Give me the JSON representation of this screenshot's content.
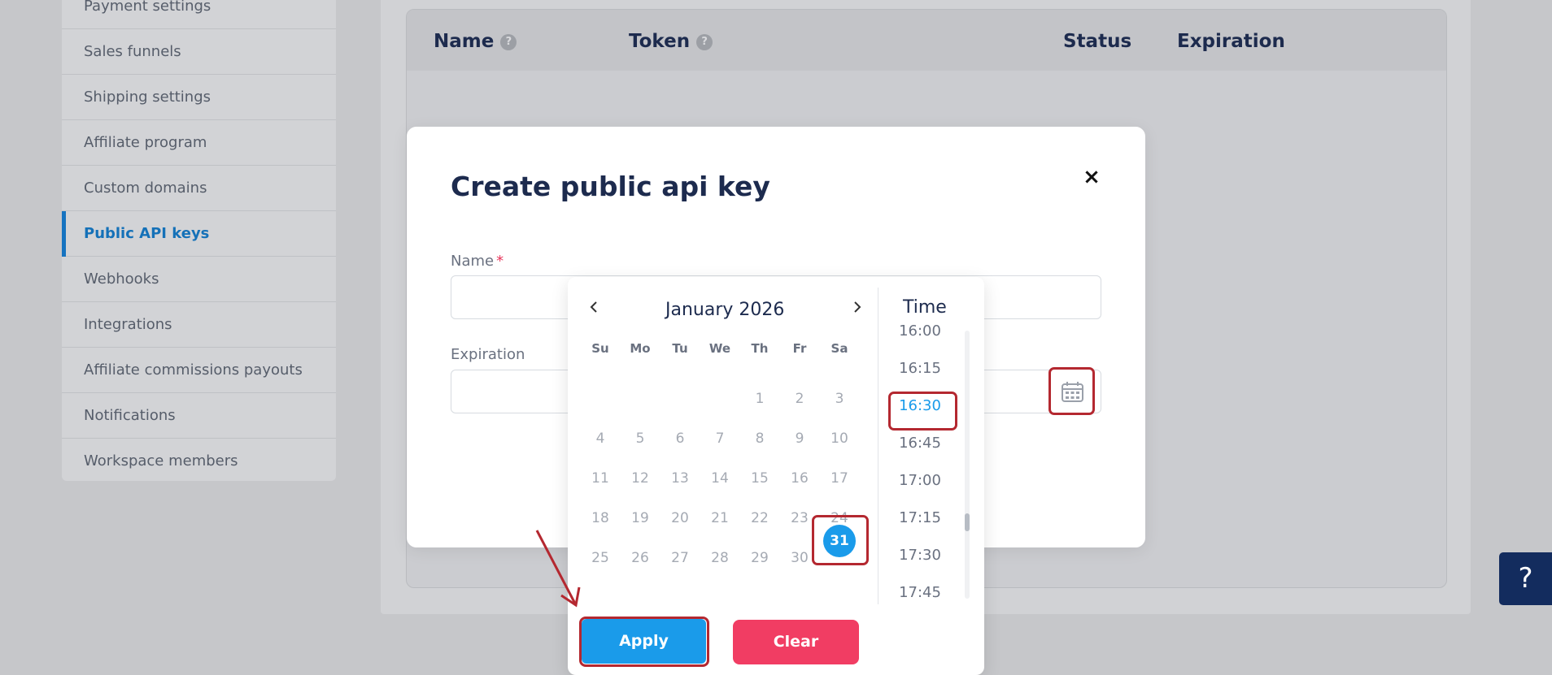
{
  "sidebar": {
    "items": [
      {
        "label": "Payment settings"
      },
      {
        "label": "Sales funnels"
      },
      {
        "label": "Shipping settings"
      },
      {
        "label": "Affiliate program"
      },
      {
        "label": "Custom domains"
      },
      {
        "label": "Public API keys"
      },
      {
        "label": "Webhooks"
      },
      {
        "label": "Integrations"
      },
      {
        "label": "Affiliate commissions payouts"
      },
      {
        "label": "Notifications"
      },
      {
        "label": "Workspace members"
      }
    ]
  },
  "table": {
    "columns": [
      "Name",
      "Token",
      "Status",
      "Expiration"
    ],
    "help_glyph": "?"
  },
  "modal": {
    "title": "Create public api key",
    "close_glyph": "×",
    "name_label": "Name",
    "required_mark": "*",
    "expiration_label": "Expiration"
  },
  "datepicker": {
    "month_label": "January 2026",
    "weekdays": [
      "Su",
      "Mo",
      "Tu",
      "We",
      "Th",
      "Fr",
      "Sa"
    ],
    "days": [
      "1",
      "2",
      "3",
      "4",
      "5",
      "6",
      "7",
      "8",
      "9",
      "10",
      "11",
      "12",
      "13",
      "14",
      "15",
      "16",
      "17",
      "18",
      "19",
      "20",
      "21",
      "22",
      "23",
      "24",
      "25",
      "26",
      "27",
      "28",
      "29",
      "30",
      "31"
    ],
    "selected_day": "31",
    "time_title": "Time",
    "times": [
      "16:00",
      "16:15",
      "16:30",
      "16:45",
      "17:00",
      "17:15",
      "17:30",
      "17:45"
    ],
    "selected_time": "16:30",
    "apply_label": "Apply",
    "clear_label": "Clear"
  },
  "help_button": {
    "label": "?"
  },
  "colors": {
    "accent": "#1a9bea",
    "danger": "#f13d63",
    "highlight": "#b42830",
    "navy": "#1d2b4e"
  }
}
